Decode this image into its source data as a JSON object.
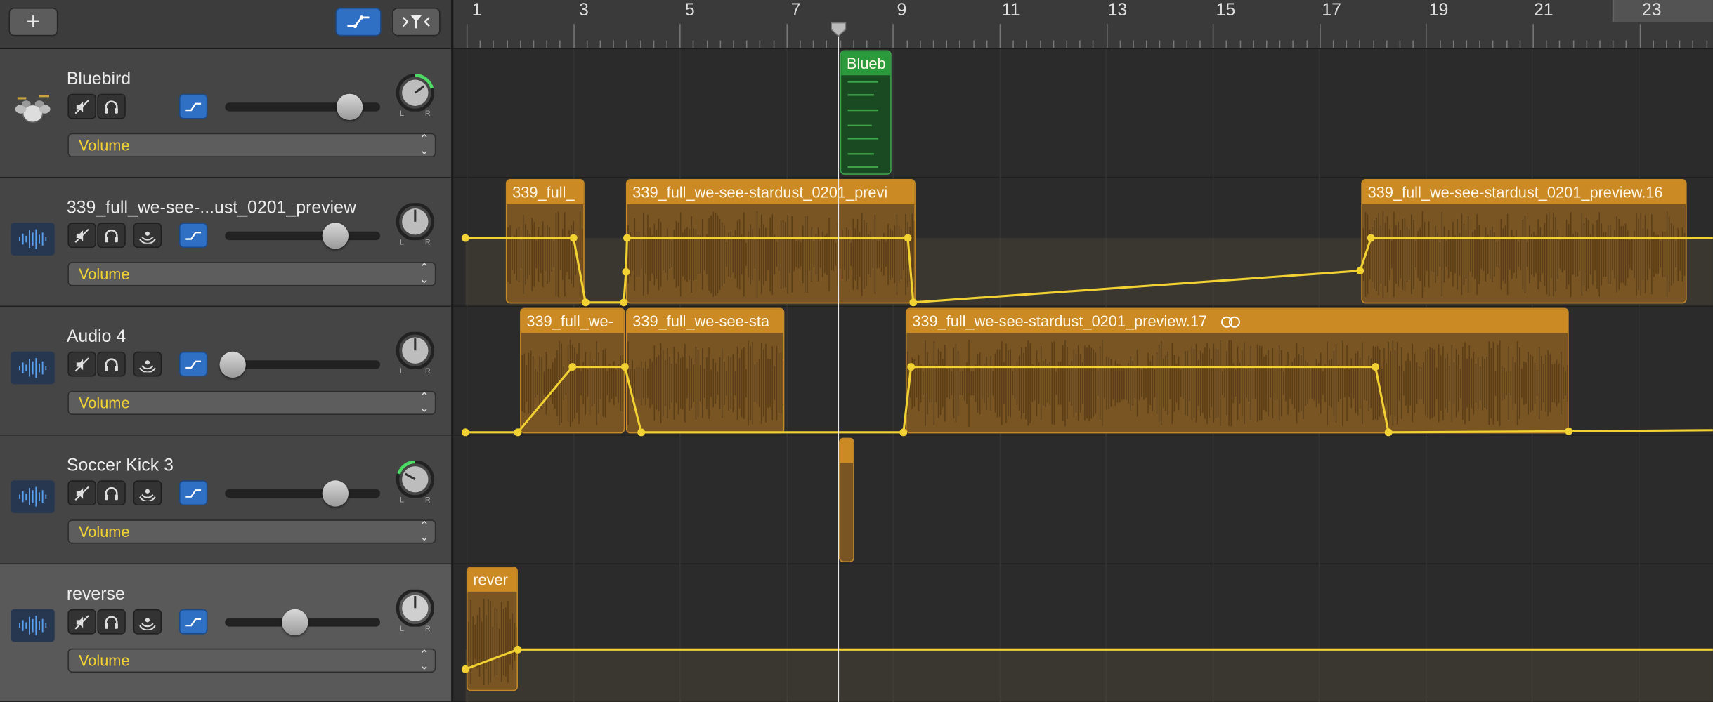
{
  "toolbar": {
    "add_label": "+",
    "automation_icon": "automation-curve-icon",
    "filter_icon": "funnel-filter-icon"
  },
  "ruler": {
    "bars": [
      "1",
      "3",
      "5",
      "7",
      "9",
      "11",
      "13",
      "15",
      "17",
      "19",
      "21",
      "23"
    ]
  },
  "tracks": [
    {
      "name": "Bluebird",
      "type": "drummer",
      "automation": "Volume",
      "volume": 0.8,
      "pan": 0.45,
      "pan_color": "#4cd964"
    },
    {
      "name": "339_full_we-see-...ust_0201_preview",
      "type": "audio",
      "automation": "Volume",
      "volume": 0.72,
      "pan": 0.5,
      "pan_color": "#888888"
    },
    {
      "name": "Audio 4",
      "type": "audio",
      "automation": "Volume",
      "volume": 0.05,
      "pan": 0.5,
      "pan_color": "#888888"
    },
    {
      "name": "Soccer Kick 3",
      "type": "audio",
      "automation": "Volume",
      "volume": 0.72,
      "pan": 0.2,
      "pan_color": "#4cd964"
    },
    {
      "name": "reverse",
      "type": "audio",
      "automation": "Volume",
      "volume": 0.45,
      "pan": 0.5,
      "pan_color": "#888888"
    }
  ],
  "regions": [
    {
      "label": "Blueb",
      "track": 0,
      "color": "green"
    },
    {
      "label": "339_full_",
      "track": 1,
      "color": "orange"
    },
    {
      "label": "339_full_we-see-stardust_0201_previ",
      "track": 1,
      "color": "orange"
    },
    {
      "label": "339_full_we-see-stardust_0201_preview.16",
      "track": 1,
      "color": "orange"
    },
    {
      "label": "339_full_we-",
      "track": 2,
      "color": "orange"
    },
    {
      "label": "339_full_we-see-sta",
      "track": 2,
      "color": "orange"
    },
    {
      "label": "339_full_we-see-stardust_0201_preview.17",
      "track": 2,
      "color": "orange",
      "loop_icon": "loop-link-icon"
    },
    {
      "label": "",
      "track": 3,
      "color": "orange"
    },
    {
      "label": "rever",
      "track": 4,
      "color": "orange"
    }
  ],
  "colors": {
    "accent_blue": "#2f6fc4",
    "automation_yellow": "#f2d133",
    "region_orange": "#cc8a24",
    "region_green": "#2a9a3d"
  },
  "labels": {
    "pan_left": "L",
    "pan_right": "R"
  }
}
